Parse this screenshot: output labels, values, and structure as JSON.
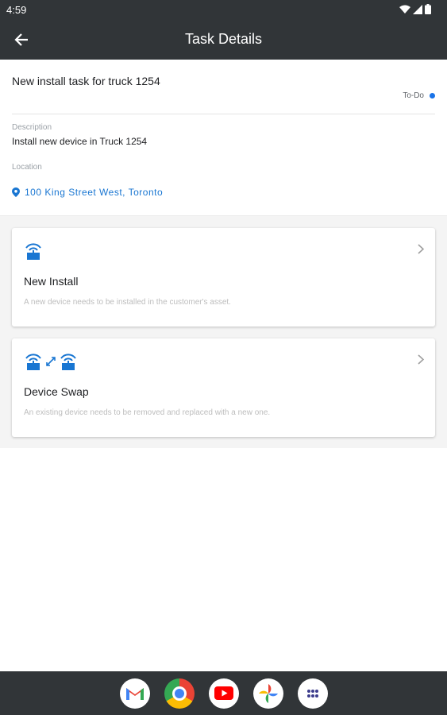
{
  "status_bar": {
    "time": "4:59"
  },
  "app_bar": {
    "title": "Task Details"
  },
  "task": {
    "title": "New install task for truck 1254",
    "status": "To-Do",
    "status_color": "#1a73e8",
    "description_label": "Description",
    "description": "Install new device in Truck 1254",
    "location_label": "Location",
    "location": "100 King Street West, Toronto"
  },
  "cards": [
    {
      "icon": "device-install-icon",
      "title": "New Install",
      "subtitle": "A new device needs to be installed in the customer's asset."
    },
    {
      "icon": "device-swap-icon",
      "title": "Device Swap",
      "subtitle": "An existing device needs to be removed and replaced with a new one."
    }
  ],
  "nav_apps": [
    "gmail-icon",
    "chrome-icon",
    "youtube-icon",
    "photos-icon",
    "app-drawer-icon"
  ],
  "colors": {
    "bar": "#313538",
    "accent": "#1976d2"
  }
}
